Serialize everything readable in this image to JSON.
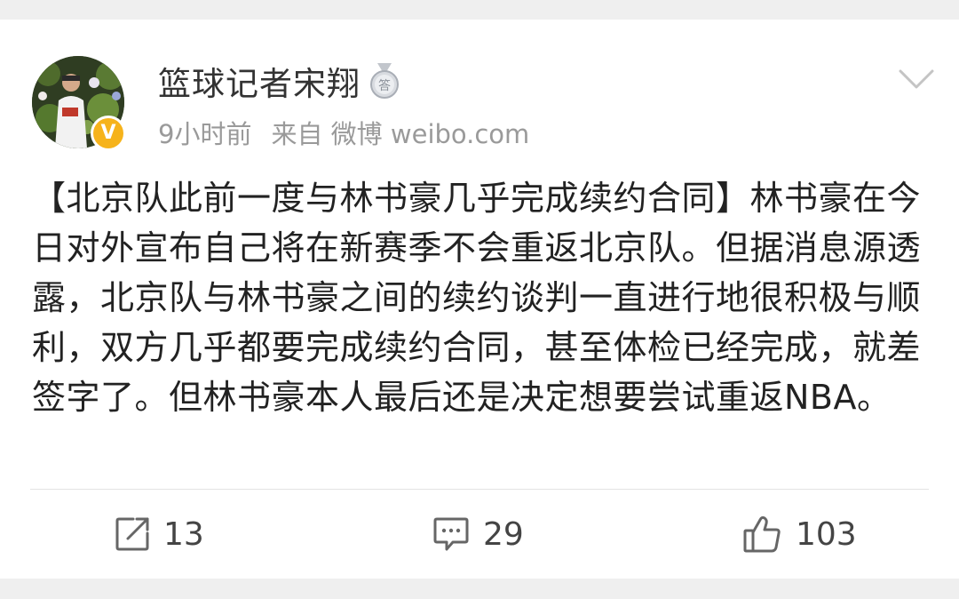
{
  "post": {
    "username": "篮球记者宋翔",
    "verified_badge": "V",
    "meta": {
      "time": "9小时前",
      "source": "来自 微博 weibo.com"
    },
    "content": "【北京队此前一度与林书豪几乎完成续约合同】林书豪在今日对外宣布自己将在新赛季不会重返北京队。但据消息源透露，北京队与林书豪之间的续约谈判一直进行地很积极与顺利，双方几乎都要完成续约合同，甚至体检已经完成，就差签字了。但林书豪本人最后还是决定想要尝试重返NBA。",
    "medal_glyph": "答"
  },
  "actions": {
    "repost_count": "13",
    "comment_count": "29",
    "like_count": "103"
  },
  "colors": {
    "background": "#efefef",
    "card": "#ffffff",
    "verified_orange": "#f6b31b",
    "meta_gray": "#9a9a9a",
    "text": "#222222"
  },
  "icons": {
    "avatar": "avatar",
    "verified": "verified-v-icon",
    "medal": "medal-icon",
    "menu": "chevron-down-icon",
    "repost": "repost-icon",
    "comment": "comment-icon",
    "like": "thumbs-up-icon"
  }
}
